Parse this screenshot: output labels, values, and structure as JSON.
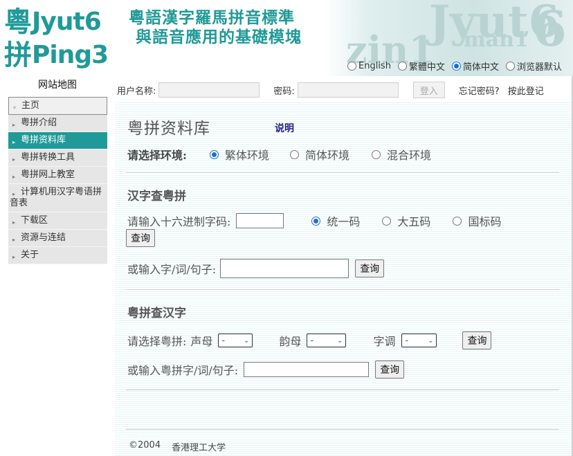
{
  "header": {
    "logo": {
      "line1_cjk": "粵",
      "line1_latin": "Jyut6",
      "line2_cjk": "拼",
      "line2_latin": "Ping3"
    },
    "tagline_line1": "粵語漢字羅馬拼音標準",
    "tagline_line2": "與語音應用的基礎模塊",
    "watermark": {
      "text1": "Jyut6",
      "text2": "zin1",
      "text3": "man1",
      "text4": "6"
    },
    "languages": [
      {
        "label": "English",
        "selected": false
      },
      {
        "label": "繁體中文",
        "selected": false
      },
      {
        "label": "简体中文",
        "selected": true
      },
      {
        "label": "浏览器默认",
        "selected": false
      }
    ]
  },
  "sidebar": {
    "sitemap": "网站地图",
    "items": [
      {
        "label": "主页"
      },
      {
        "label": "粤拼介绍"
      },
      {
        "label": "粤拼资料库",
        "active": true
      },
      {
        "label": "粤拼转换工具"
      },
      {
        "label": "粤拼网上教室"
      },
      {
        "label": "计算机用汉字粤语拼",
        "label2": "音表"
      },
      {
        "label": "下载区"
      },
      {
        "label": "资源与连结"
      },
      {
        "label": "关于"
      }
    ]
  },
  "login": {
    "username_label": "用户名称:",
    "password_label": "密码:",
    "login_button": "登入",
    "forgot_password": "忘记密码?",
    "register": "按此登记"
  },
  "main": {
    "title": "粤拼资料库",
    "help_link": "说明",
    "environment": {
      "label": "请选择环境:",
      "options": [
        {
          "label": "繁体环境",
          "selected": true
        },
        {
          "label": "简体环境",
          "selected": false
        },
        {
          "label": "混合环境",
          "selected": false
        }
      ]
    },
    "hanzi_lookup": {
      "title": "汉字查粤拼",
      "hex_label": "请输入十六进制字码:",
      "encodings": [
        {
          "label": "统一码",
          "selected": true
        },
        {
          "label": "大五码",
          "selected": false
        },
        {
          "label": "国标码",
          "selected": false
        }
      ],
      "query_button": "查询",
      "text_label": "或输入字/词/句子:",
      "query_button2": "查询"
    },
    "jyutping_lookup": {
      "title": "粤拼查汉字",
      "select_label": "请选择粤拼:",
      "initial_label": "声母",
      "initial_value": "-",
      "final_label": "韵母",
      "final_value": "-",
      "tone_label": "字调",
      "tone_value": "-",
      "query_button": "查询",
      "text_label": "或输入粤拼字/词/句子:",
      "query_button2": "查询"
    },
    "footer": {
      "copyright": "©2004",
      "org": "香港理工大学"
    }
  },
  "colors": {
    "brand_teal": "#1f9a98",
    "help_link": "#1e1e8a",
    "radio_accent": "#1a6fd9"
  }
}
